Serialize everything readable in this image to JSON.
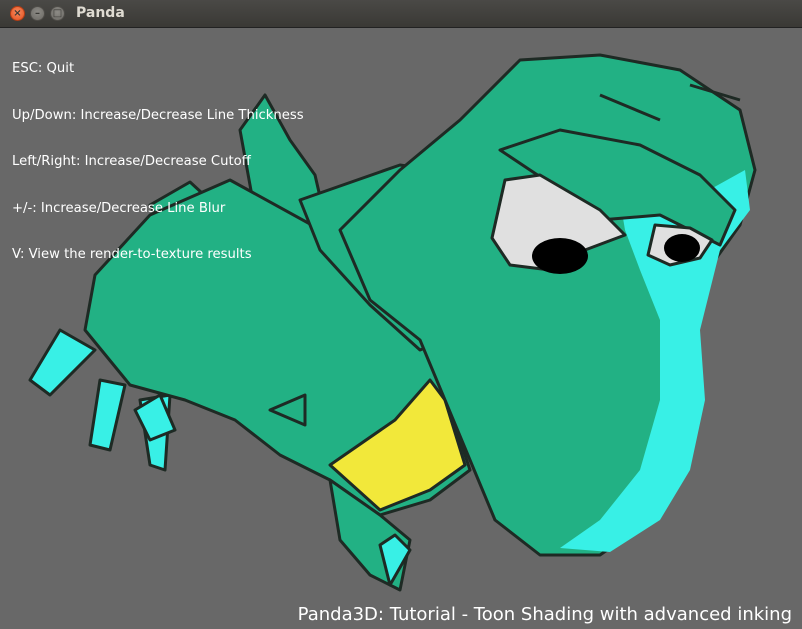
{
  "window": {
    "title": "Panda",
    "close_glyph": "×",
    "minimize_glyph": "–",
    "maximize_glyph": "□"
  },
  "help_lines": [
    "ESC: Quit",
    "Up/Down: Increase/Decrease Line Thickness",
    "Left/Right: Increase/Decrease Cutoff",
    "+/-: Increase/Decrease Line Blur",
    "V: View the render-to-texture results"
  ],
  "caption": "Panda3D: Tutorial - Toon Shading with advanced inking",
  "colors": {
    "background": "#686868",
    "body": "#22b184",
    "highlight": "#38f0e6",
    "ink": "#1e2a24",
    "belly": "#f2e83a",
    "eye_white": "#e0e0e0"
  },
  "icons": {
    "close": "close-icon",
    "minimize": "minimize-icon",
    "maximize": "maximize-icon"
  }
}
